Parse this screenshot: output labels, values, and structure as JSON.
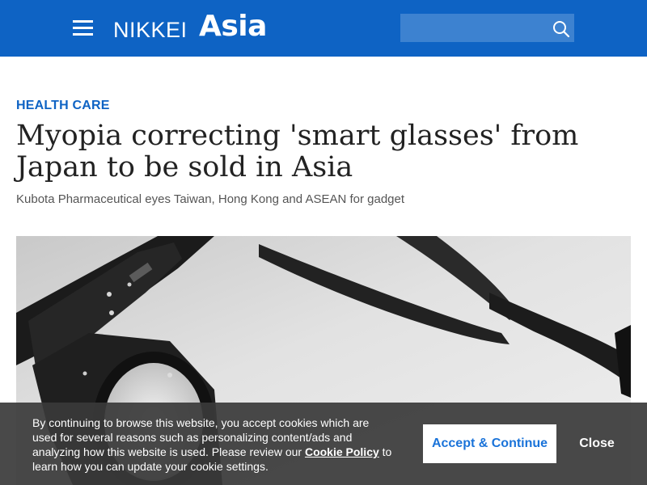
{
  "header": {
    "logo_nikkei": "NIKKEI",
    "logo_asia": "Asia",
    "background_color": "#0e63c4",
    "menu_icon": "hamburger-menu-icon",
    "search": {
      "placeholder": "",
      "icon": "search-icon"
    }
  },
  "article": {
    "section": "HEALTH CARE",
    "title": "Myopia correcting 'smart glasses' from Japan to be sold in Asia",
    "subtitle": "Kubota Pharmaceutical eyes Taiwan, Hong Kong and ASEAN for gadget",
    "section_color": "#0e63c4"
  },
  "cookie_banner": {
    "text_before_link": "By continuing to browse this website, you accept cookies which are used for several reasons such as personalizing content/ads and analyzing how this website is used. Please review our ",
    "link_label": "Cookie Policy",
    "text_after_link": " to learn how you can update your cookie settings.",
    "accept_label": "Accept & Continue",
    "close_label": "Close",
    "accent_color": "#1a73d9"
  }
}
